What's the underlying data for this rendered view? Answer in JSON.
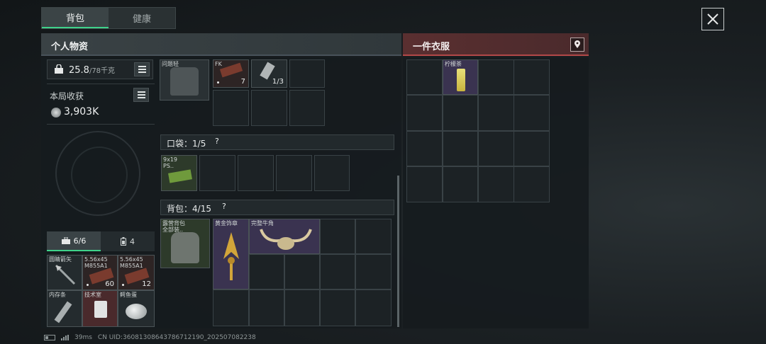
{
  "tabs": [
    {
      "label": "背包",
      "active": true
    },
    {
      "label": "健康",
      "active": false
    }
  ],
  "left_header": {
    "title": "个人物资"
  },
  "right_header": {
    "title": "一件衣服"
  },
  "weight": {
    "current": "25.8",
    "max": "/78千克"
  },
  "harvest": {
    "label": "本局收获",
    "value": "3,903K"
  },
  "mini_tabs": [
    {
      "label": "6/6",
      "icon": "toolbox-icon",
      "active": true
    },
    {
      "label": "4",
      "icon": "battery-icon",
      "active": false
    }
  ],
  "quick_items": [
    {
      "name": "圆睛箭矢",
      "qty": ""
    },
    {
      "name": "5.56x45\nM855A1",
      "qty": "60"
    },
    {
      "name": "5.56x45\nM855A1",
      "qty": "12"
    },
    {
      "name": "内存条",
      "qty": ""
    },
    {
      "name": "技术室",
      "qty": ""
    },
    {
      "name": "鳄鱼蛋",
      "qty": ""
    }
  ],
  "top_items": [
    {
      "name": "问题轻",
      "qty": ""
    },
    {
      "name": "FK",
      "qty": "7"
    },
    {
      "name": "",
      "qty": "1/3"
    }
  ],
  "pocket": {
    "label": "口袋：",
    "count": "1/5",
    "help": "?"
  },
  "pocket_items": [
    {
      "name": "9x19\nPS..",
      "qty": ""
    }
  ],
  "backpack": {
    "label": "背包：",
    "count": "4/15",
    "help": "?"
  },
  "backpack_equipped": {
    "name": "露营背包\n全部装.."
  },
  "backpack_items": [
    {
      "name": "黄金饰章"
    },
    {
      "name": "完整牛角"
    }
  ],
  "clothes_items": [
    {
      "name": "柠檬茶"
    }
  ],
  "status": {
    "ping": "39ms",
    "uid": "CN UID:36081308643786712190_202507082238"
  },
  "colors": {
    "accent": "#3fd28a",
    "danger": "#b34848",
    "gold_bg": "#3a3350",
    "red_bg": "#4a2a2c"
  }
}
